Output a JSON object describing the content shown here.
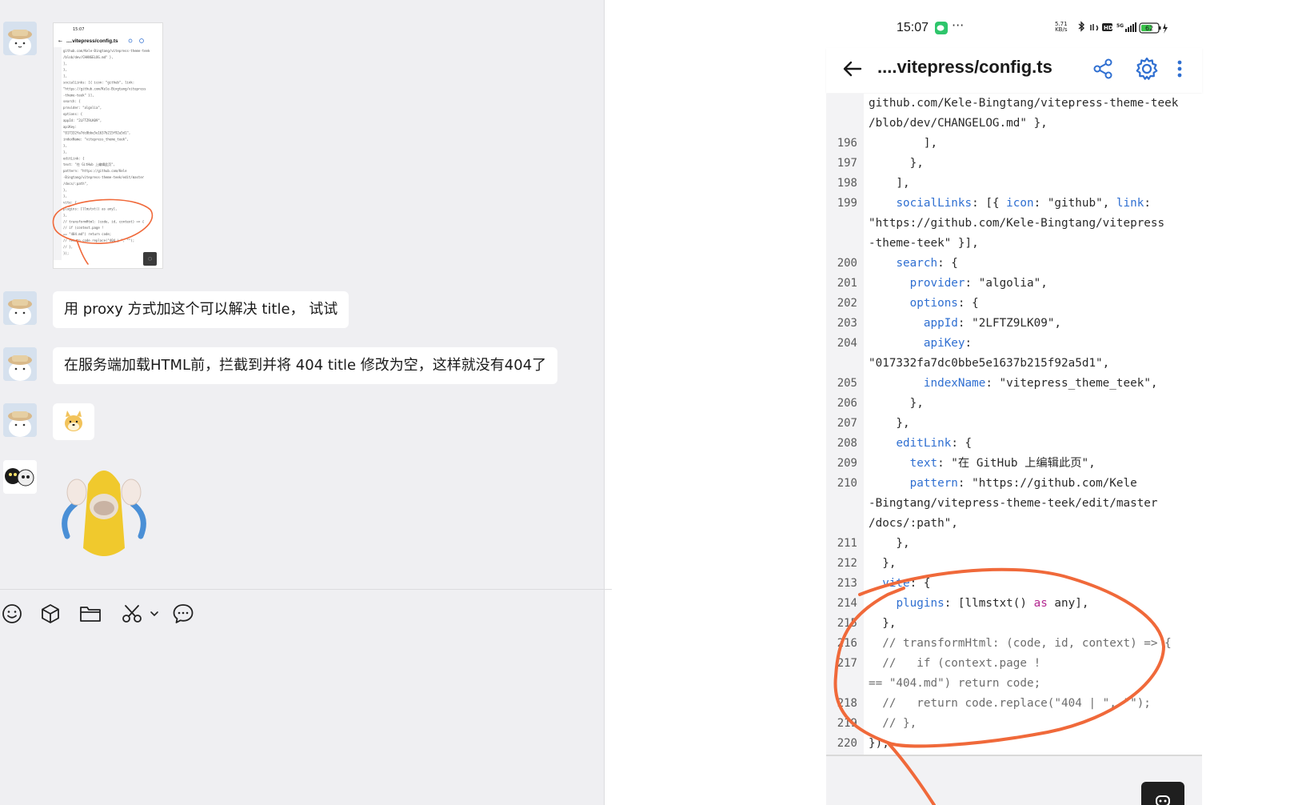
{
  "chat": {
    "messages": [
      {
        "type": "image",
        "thumbnail": {
          "status_time": "15:07",
          "title": "....vitepress/config.ts",
          "preview_lines": [
            "github.com/Kele-Bingtang/vitepress-theme-teek",
            "/blob/dev/CHANGELOG.md\" },",
            "  ],",
            "  },",
            " ],",
            " socialLinks: [{ icon: \"github\", link:",
            "\"https://github.com/Kele-Bingtang/vitepress",
            "-theme-teek\" }],",
            " search: {",
            "  provider: \"algolia\",",
            "  options: {",
            "   appId: \"2LFTZ9LK09\",",
            "   apiKey:",
            "\"017332fa7dc0bbe5e1637b215f92a5d1\",",
            "    indexName: \"vitepress_theme_teek\",",
            "   },",
            "  },",
            "  editLink: {",
            "   text: \"在 GitHub 上编辑此页\",",
            "   pattern: \"https://github.com/Kele",
            "-Bingtang/vitepress-theme-teek/edit/master",
            "/docs/:path\",",
            "  },",
            " },",
            " vite: {",
            "  plugins: [llmstxt() as any],",
            " },",
            " // transformHtml: (code, id, context) => {",
            " //   if (context.page !",
            "== \"404.md\") return code;",
            " //   return code.replace(\"404 | \", \"\");",
            " // },",
            "});"
          ]
        }
      },
      {
        "type": "text",
        "text": "用 proxy 方式加这个可以解决 title，  试试"
      },
      {
        "type": "text",
        "text": "在服务端加载HTML前，拦截到并将 404 title 修改为空，这样就没有404了"
      },
      {
        "type": "emoji",
        "icon": "doge-emoji-icon"
      },
      {
        "type": "sticker",
        "icon": "banana-cat-sticker-icon"
      }
    ],
    "toolbar": [
      "smiley-icon",
      "package-icon",
      "folder-icon",
      "scissors-icon",
      "chevron-down-icon",
      "chat-bubble-icon"
    ]
  },
  "phone": {
    "status_bar": {
      "time": "15:07",
      "dots": "···",
      "net_speed_value": "5.71",
      "net_speed_unit": "KB/s",
      "hd_label": "HD",
      "network": "5G",
      "battery": "62"
    },
    "app_bar": {
      "title": "....vitepress/config.ts"
    },
    "code_lines": [
      {
        "n": "",
        "html": "github.com/Kele-Bingtang/vitepress-theme-teek"
      },
      {
        "n": "",
        "html": "/blob/dev/CHANGELOG.md\" },"
      },
      {
        "n": "196",
        "html": "        ],"
      },
      {
        "n": "197",
        "html": "      },"
      },
      {
        "n": "198",
        "html": "    ],"
      },
      {
        "n": "199",
        "html": "    socialLinks: [{ icon: \"github\", link:",
        "keys": [
          "socialLinks",
          "icon",
          "link"
        ]
      },
      {
        "n": "",
        "html": "\"https://github.com/Kele-Bingtang/vitepress"
      },
      {
        "n": "",
        "html": "-theme-teek\" }],"
      },
      {
        "n": "200",
        "html": "    search: {",
        "keys": [
          "search"
        ]
      },
      {
        "n": "201",
        "html": "      provider: \"algolia\",",
        "keys": [
          "provider"
        ]
      },
      {
        "n": "202",
        "html": "      options: {",
        "keys": [
          "options"
        ]
      },
      {
        "n": "203",
        "html": "        appId: \"2LFTZ9LK09\",",
        "keys": [
          "appId"
        ]
      },
      {
        "n": "204",
        "html": "        apiKey:",
        "keys": [
          "apiKey"
        ]
      },
      {
        "n": "",
        "html": "\"017332fa7dc0bbe5e1637b215f92a5d1\","
      },
      {
        "n": "205",
        "html": "        indexName: \"vitepress_theme_teek\",",
        "keys": [
          "indexName"
        ]
      },
      {
        "n": "206",
        "html": "      },"
      },
      {
        "n": "207",
        "html": "    },"
      },
      {
        "n": "208",
        "html": "    editLink: {",
        "keys": [
          "editLink"
        ]
      },
      {
        "n": "209",
        "html": "      text: \"在 GitHub 上编辑此页\",",
        "keys": [
          "text"
        ]
      },
      {
        "n": "210",
        "html": "      pattern: \"https://github.com/Kele",
        "keys": [
          "pattern"
        ]
      },
      {
        "n": "",
        "html": "-Bingtang/vitepress-theme-teek/edit/master"
      },
      {
        "n": "",
        "html": "/docs/:path\","
      },
      {
        "n": "211",
        "html": "    },"
      },
      {
        "n": "212",
        "html": "  },"
      },
      {
        "n": "213",
        "html": "  vite: {",
        "keys": [
          "vite"
        ]
      },
      {
        "n": "214",
        "html": "    plugins: [llmstxt() as any],",
        "keys": [
          "plugins"
        ],
        "kw": [
          "as"
        ]
      },
      {
        "n": "215",
        "html": "  },"
      },
      {
        "n": "216",
        "html": "  // transformHtml: (code, id, context) => {",
        "comment": true
      },
      {
        "n": "217",
        "html": "  //   if (context.page !",
        "comment": true
      },
      {
        "n": "",
        "html": "== \"404.md\") return code;",
        "comment": true
      },
      {
        "n": "218",
        "html": "  //   return code.replace(\"404 | \", \"\");",
        "comment": true
      },
      {
        "n": "219",
        "html": "  // },",
        "comment": true
      },
      {
        "n": "220",
        "html": "});"
      }
    ]
  },
  "colors": {
    "chat_bg": "#efeff2",
    "bubble_bg": "#ffffff",
    "code_key": "#2f6fd1",
    "annotation": "#f0693a",
    "line_number_gutter": "#f3f3f5"
  }
}
